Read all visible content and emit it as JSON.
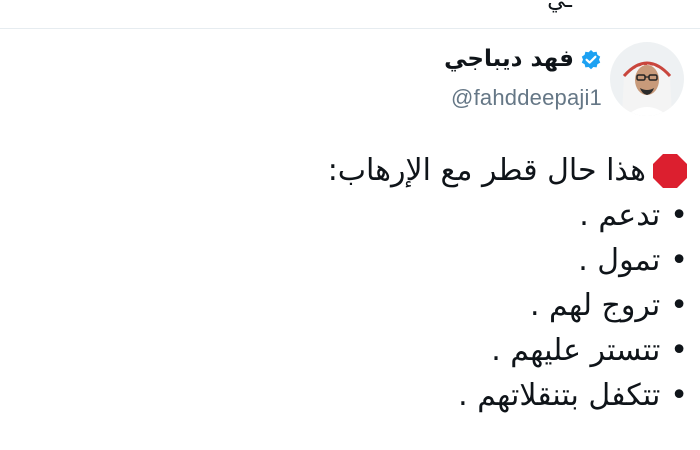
{
  "top": {
    "partial_text": "ـي"
  },
  "author": {
    "name": "فهد ديباجي",
    "handle": "@fahddeepaji1",
    "verified": true,
    "verified_color": "#1da1f2"
  },
  "tweet": {
    "headline_icon": "stop-sign-icon",
    "headline": "هذا حال قطر مع الإرهاب:",
    "bullet_char": "•",
    "bullets": [
      "تدعم .",
      "تمول .",
      "تروج لهم .",
      "تتستر عليهم .",
      "تتكفل بتنقلاتهم ."
    ]
  },
  "bottom": {
    "partial_text": "ـــــ ــــ ـــ ــــــ ـ ـــــ"
  },
  "colors": {
    "text": "#0f1419",
    "handle": "#657786",
    "stop": "#dc1f2f",
    "divider": "#e6ecf0"
  }
}
